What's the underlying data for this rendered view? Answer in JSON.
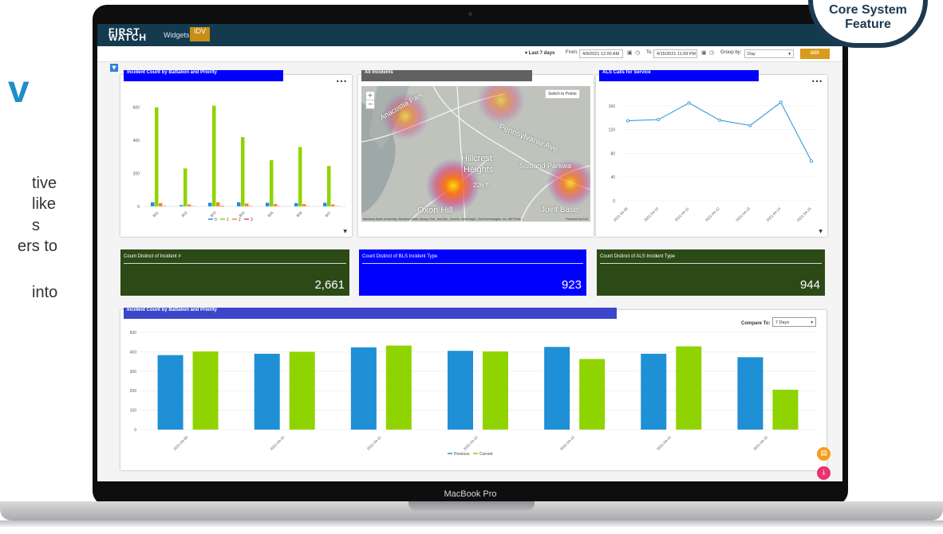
{
  "background": {
    "heading_fragment": "v",
    "lines": [
      "tive",
      "like",
      "s",
      "ers to",
      "into"
    ]
  },
  "badge": {
    "line1": "Core System",
    "line2": "Feature"
  },
  "laptop": {
    "model_label": "MacBook Pro"
  },
  "app": {
    "logo_line1": "FIRST",
    "logo_line2": "WATCH",
    "nav": {
      "widgets_label": "Widgets",
      "idv_label": "IDV"
    }
  },
  "filters": {
    "range_label": "▾ Last 7 days",
    "from_label": "From:",
    "from_value": "4/9/2021 12:00 AM",
    "to_label": "To:",
    "to_value": "4/15/2021 11:59 PM",
    "group_label": "Group by:",
    "group_value": "Day",
    "go_label": "GO!"
  },
  "colors": {
    "title_blue": "#0000ff",
    "kpi_green": "#2b4a16",
    "kpi_blue": "#0000ff",
    "series_blue": "#1f8fd6",
    "series_green": "#8fd400",
    "series_orange": "#f28c1b",
    "series_pink": "#e8457a",
    "line_blue": "#2893d6"
  },
  "panels": {
    "battalion": {
      "title": "Incident Count by Battalion and Priority"
    },
    "map": {
      "title": "All Incidents",
      "switch_label": "Switch to Points",
      "labels": [
        "Anacostia Park",
        "Pennsylvania Ave",
        "Hillcrest",
        "Heights",
        "Suitland Parkwa",
        "226 ft",
        "Oxon Hill",
        "Joint Base"
      ],
      "attribution": "Montana State University, Montana State Library, Esri, TomTom, Garmin, SafeGraph, GeoTechnologies, Inc, METI/NA...",
      "powered": "Powered by Esri"
    },
    "als": {
      "title": "ALS Calls for Service"
    },
    "kpis": [
      {
        "label": "Count Distinct of Incident #",
        "value": "2,661"
      },
      {
        "label": "Count Distinct of BLS Incident Type",
        "value": "923"
      },
      {
        "label": "Count Distinct of ALS Incident Type",
        "value": "944"
      }
    ],
    "compare": {
      "title": "Incident Count by Battalion and Priority",
      "compare_label": "Compare To:",
      "compare_value": "7 Days"
    }
  },
  "chart_data": [
    {
      "type": "bar",
      "title": "Incident Count by Battalion and Priority",
      "categories": [
        "B01",
        "B02",
        "B03",
        "B04",
        "B05",
        "B06",
        "B07"
      ],
      "ylim": [
        0,
        700
      ],
      "yticks": [
        0,
        200,
        400,
        600
      ],
      "series": [
        {
          "name": "0",
          "color": "#1f8fd6",
          "values": [
            25,
            8,
            22,
            25,
            22,
            20,
            22
          ]
        },
        {
          "name": "1",
          "color": "#8fd400",
          "values": [
            600,
            230,
            610,
            420,
            280,
            360,
            245
          ]
        },
        {
          "name": "2",
          "color": "#f28c1b",
          "values": [
            20,
            12,
            25,
            18,
            15,
            14,
            12
          ]
        },
        {
          "name": "3",
          "color": "#e8457a",
          "values": [
            3,
            2,
            4,
            3,
            2,
            2,
            2
          ]
        }
      ],
      "legend": "bottom"
    },
    {
      "type": "line",
      "title": "ALS Calls for Service",
      "x": [
        "2021-04-09",
        "2021-04-10",
        "2021-04-11",
        "2021-04-12",
        "2021-04-13",
        "2021-04-14",
        "2021-04-15"
      ],
      "y": [
        135,
        137,
        165,
        136,
        127,
        166,
        67
      ],
      "ylim": [
        0,
        180
      ],
      "yticks": [
        0,
        40,
        80,
        120,
        160
      ]
    },
    {
      "type": "bar",
      "title": "Incident Count by Battalion and Priority",
      "categories": [
        "2021-04-09",
        "2021-04-10",
        "2021-04-11",
        "2021-04-12",
        "2021-04-13",
        "2021-04-14",
        "2021-04-15"
      ],
      "ylim": [
        0,
        500
      ],
      "yticks": [
        0,
        100,
        200,
        300,
        400,
        500
      ],
      "series": [
        {
          "name": "Previous",
          "color": "#1f8fd6",
          "values": [
            383,
            390,
            423,
            405,
            425,
            390,
            372
          ]
        },
        {
          "name": "Current",
          "color": "#8fd400",
          "values": [
            402,
            400,
            432,
            402,
            363,
            428,
            205
          ]
        }
      ],
      "legend": "bottom"
    }
  ]
}
